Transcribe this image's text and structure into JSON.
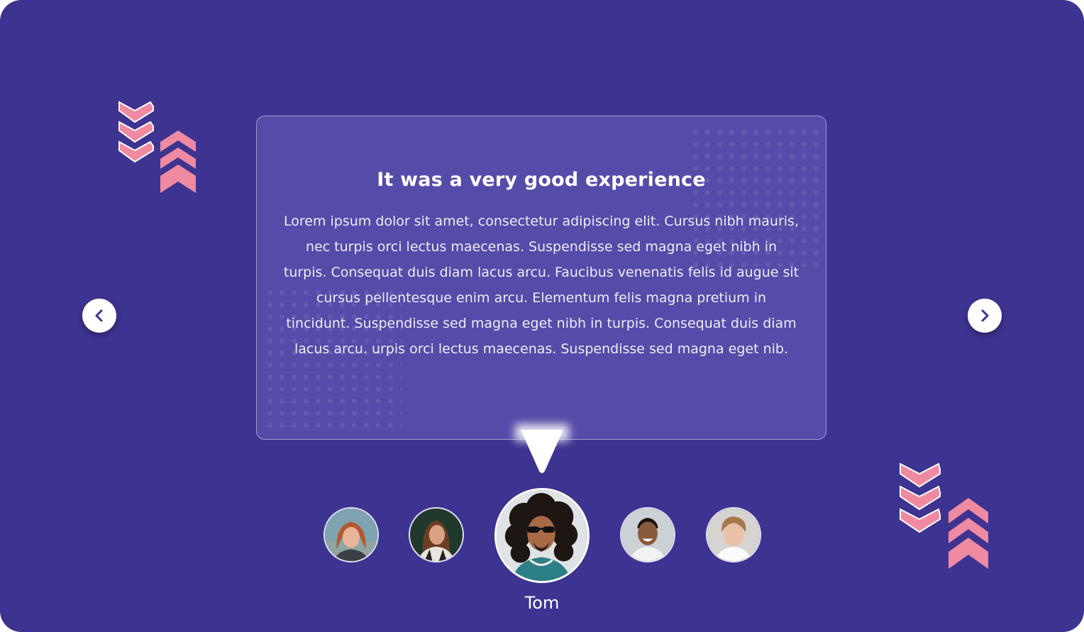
{
  "testimonial": {
    "title": "It was a very good experience",
    "body": "Lorem ipsum dolor sit amet, consectetur adipiscing elit. Cursus nibh mauris, nec turpis orci lectus maecenas. Suspendisse sed magna eget nibh in turpis. Consequat duis diam lacus arcu. Faucibus venenatis felis id augue sit cursus pellentesque enim arcu. Elementum felis magna pretium in tincidunt. Suspendisse sed magna eget nibh in turpis. Consequat duis diam lacus arcu. urpis orci lectus maecenas. Suspendisse sed magna eget nib."
  },
  "navigation": {
    "prev_icon": "chevron-left-icon",
    "next_icon": "chevron-right-icon"
  },
  "avatars": [
    {
      "icon": "avatar-photo",
      "active": false
    },
    {
      "icon": "avatar-photo",
      "active": false
    },
    {
      "icon": "avatar-photo",
      "active": true,
      "name": "Tom"
    },
    {
      "icon": "avatar-photo",
      "active": false
    },
    {
      "icon": "avatar-photo",
      "active": false
    }
  ],
  "colors": {
    "background": "#3d3391",
    "accent": "#f08aa0",
    "card": "#5a4fb0",
    "text": "#ffffff"
  }
}
